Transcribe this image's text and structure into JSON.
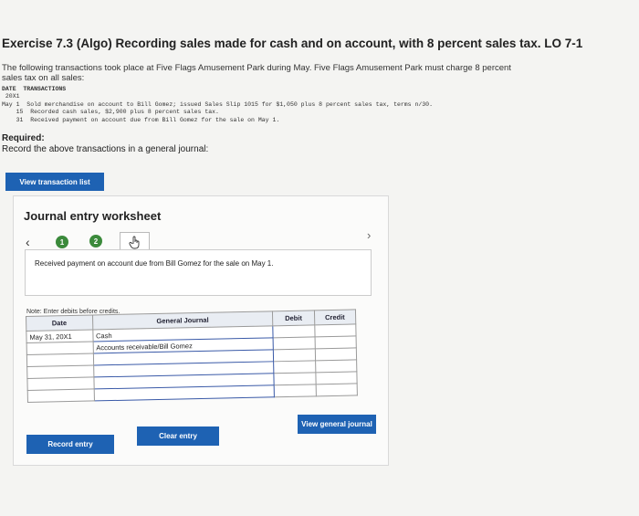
{
  "title": "Exercise 7.3 (Algo) Recording sales made for cash and on account, with 8 percent sales tax. LO 7-1",
  "intro": "The following transactions took place at Five Flags Amusement Park during May. Five Flags Amusement Park must charge 8 percent sales tax on all sales:",
  "transactions": {
    "header": "DATE  TRANSACTIONS",
    "year": " 20X1",
    "lines": [
      "May 1  Sold merchandise on account to Bill Gomez; issued Sales Slip 1015 for $1,050 plus 8 percent sales tax, terms n/30.",
      "    15  Recorded cash sales, $2,900 plus 8 percent sales tax.",
      "    31  Received payment on account due from Bill Gomez for the sale on May 1."
    ]
  },
  "required": {
    "label": "Required:",
    "text": "Record the above transactions in a general journal:"
  },
  "buttons": {
    "view_transaction_list": "View transaction list",
    "record_entry": "Record entry",
    "clear_entry": "Clear entry",
    "view_general_journal": "View general journal"
  },
  "worksheet": {
    "title": "Journal entry worksheet",
    "steps": [
      "1",
      "2"
    ],
    "description": "Received payment on account due from Bill Gomez for the sale on May 1.",
    "note": "Note: Enter debits before credits.",
    "columns": {
      "date": "Date",
      "journal": "General Journal",
      "debit": "Debit",
      "credit": "Credit"
    },
    "rows": [
      {
        "date": "May 31, 20X1",
        "account": "Cash",
        "debit": "",
        "credit": ""
      },
      {
        "date": "",
        "account": "Accounts receivable/Bill Gomez",
        "debit": "",
        "credit": ""
      },
      {
        "date": "",
        "account": "",
        "debit": "",
        "credit": ""
      },
      {
        "date": "",
        "account": "",
        "debit": "",
        "credit": ""
      },
      {
        "date": "",
        "account": "",
        "debit": "",
        "credit": ""
      },
      {
        "date": "",
        "account": "",
        "debit": "",
        "credit": ""
      }
    ]
  },
  "colors": {
    "button_blue": "#1e62b3",
    "step_green": "#3b8a3b"
  },
  "icons": {
    "prev": "chevron-left-icon",
    "next": "chevron-right-icon",
    "pointer": "hand-pointer-icon"
  }
}
